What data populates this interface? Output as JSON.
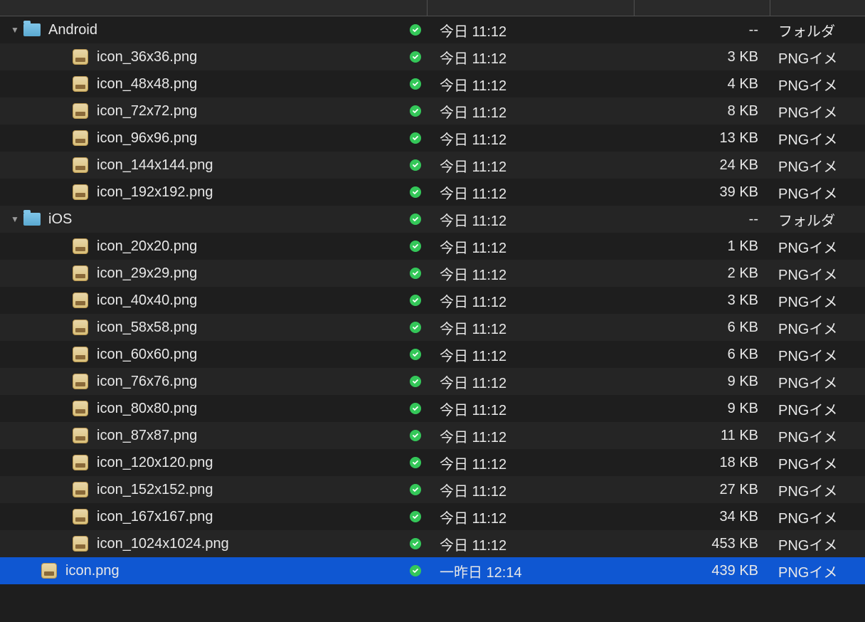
{
  "rows": [
    {
      "type": "folder",
      "name": "Android",
      "date": "今日 11:12",
      "size": "--",
      "kind": "フォルダ",
      "indent": 0,
      "expanded": true,
      "alt": false,
      "selected": false
    },
    {
      "type": "file",
      "name": "icon_36x36.png",
      "date": "今日 11:12",
      "size": "3 KB",
      "kind": "PNGイメ",
      "indent": 1,
      "alt": true,
      "selected": false
    },
    {
      "type": "file",
      "name": "icon_48x48.png",
      "date": "今日 11:12",
      "size": "4 KB",
      "kind": "PNGイメ",
      "indent": 1,
      "alt": false,
      "selected": false
    },
    {
      "type": "file",
      "name": "icon_72x72.png",
      "date": "今日 11:12",
      "size": "8 KB",
      "kind": "PNGイメ",
      "indent": 1,
      "alt": true,
      "selected": false
    },
    {
      "type": "file",
      "name": "icon_96x96.png",
      "date": "今日 11:12",
      "size": "13 KB",
      "kind": "PNGイメ",
      "indent": 1,
      "alt": false,
      "selected": false
    },
    {
      "type": "file",
      "name": "icon_144x144.png",
      "date": "今日 11:12",
      "size": "24 KB",
      "kind": "PNGイメ",
      "indent": 1,
      "alt": true,
      "selected": false
    },
    {
      "type": "file",
      "name": "icon_192x192.png",
      "date": "今日 11:12",
      "size": "39 KB",
      "kind": "PNGイメ",
      "indent": 1,
      "alt": false,
      "selected": false
    },
    {
      "type": "folder",
      "name": "iOS",
      "date": "今日 11:12",
      "size": "--",
      "kind": "フォルダ",
      "indent": 0,
      "expanded": true,
      "alt": true,
      "selected": false
    },
    {
      "type": "file",
      "name": "icon_20x20.png",
      "date": "今日 11:12",
      "size": "1 KB",
      "kind": "PNGイメ",
      "indent": 1,
      "alt": false,
      "selected": false
    },
    {
      "type": "file",
      "name": "icon_29x29.png",
      "date": "今日 11:12",
      "size": "2 KB",
      "kind": "PNGイメ",
      "indent": 1,
      "alt": true,
      "selected": false
    },
    {
      "type": "file",
      "name": "icon_40x40.png",
      "date": "今日 11:12",
      "size": "3 KB",
      "kind": "PNGイメ",
      "indent": 1,
      "alt": false,
      "selected": false
    },
    {
      "type": "file",
      "name": "icon_58x58.png",
      "date": "今日 11:12",
      "size": "6 KB",
      "kind": "PNGイメ",
      "indent": 1,
      "alt": true,
      "selected": false
    },
    {
      "type": "file",
      "name": "icon_60x60.png",
      "date": "今日 11:12",
      "size": "6 KB",
      "kind": "PNGイメ",
      "indent": 1,
      "alt": false,
      "selected": false
    },
    {
      "type": "file",
      "name": "icon_76x76.png",
      "date": "今日 11:12",
      "size": "9 KB",
      "kind": "PNGイメ",
      "indent": 1,
      "alt": true,
      "selected": false
    },
    {
      "type": "file",
      "name": "icon_80x80.png",
      "date": "今日 11:12",
      "size": "9 KB",
      "kind": "PNGイメ",
      "indent": 1,
      "alt": false,
      "selected": false
    },
    {
      "type": "file",
      "name": "icon_87x87.png",
      "date": "今日 11:12",
      "size": "11 KB",
      "kind": "PNGイメ",
      "indent": 1,
      "alt": true,
      "selected": false
    },
    {
      "type": "file",
      "name": "icon_120x120.png",
      "date": "今日 11:12",
      "size": "18 KB",
      "kind": "PNGイメ",
      "indent": 1,
      "alt": false,
      "selected": false
    },
    {
      "type": "file",
      "name": "icon_152x152.png",
      "date": "今日 11:12",
      "size": "27 KB",
      "kind": "PNGイメ",
      "indent": 1,
      "alt": true,
      "selected": false
    },
    {
      "type": "file",
      "name": "icon_167x167.png",
      "date": "今日 11:12",
      "size": "34 KB",
      "kind": "PNGイメ",
      "indent": 1,
      "alt": false,
      "selected": false
    },
    {
      "type": "file",
      "name": "icon_1024x1024.png",
      "date": "今日 11:12",
      "size": "453 KB",
      "kind": "PNGイメ",
      "indent": 1,
      "alt": true,
      "selected": false
    },
    {
      "type": "file",
      "name": "icon.png",
      "date": "一昨日 12:14",
      "size": "439 KB",
      "kind": "PNGイメ",
      "indent": 0,
      "alt": false,
      "selected": true
    }
  ]
}
